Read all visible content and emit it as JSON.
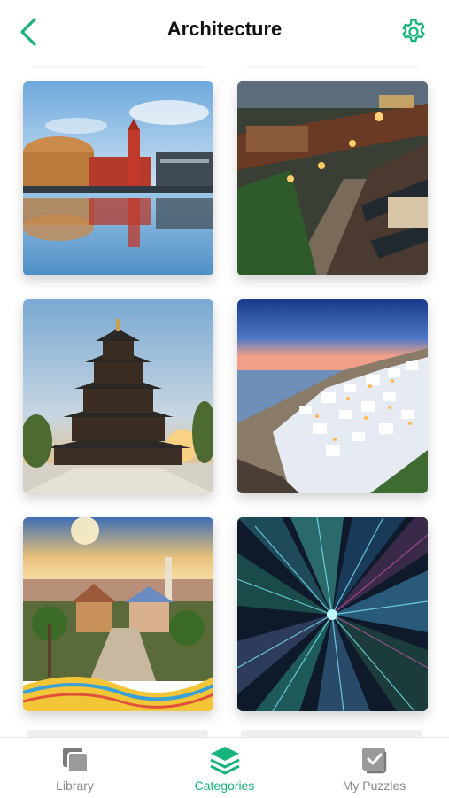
{
  "header": {
    "title": "Architecture",
    "back_icon": "chevron-left-icon",
    "settings_icon": "gear-icon",
    "accent_color": "#16b37a"
  },
  "grid": {
    "tiles": [
      {
        "subject": "waterfront city with red clock tower reflected in water"
      },
      {
        "subject": "traditional chinese street with pagoda rooftops at dusk"
      },
      {
        "subject": "multi-tiered chinese pagoda at sunset"
      },
      {
        "subject": "santorini white village on cliff at dusk"
      },
      {
        "subject": "park guell colorful mosaic bench with city view"
      },
      {
        "subject": "looking up at neon skyscrapers"
      }
    ]
  },
  "tabbar": {
    "active_color": "#16b37a",
    "inactive_color": "#8a8a8a",
    "tabs": [
      {
        "label": "Library",
        "icon": "library-icon",
        "active": false
      },
      {
        "label": "Categories",
        "icon": "layers-icon",
        "active": true
      },
      {
        "label": "My Puzzles",
        "icon": "my-puzzles-icon",
        "active": false
      }
    ]
  }
}
